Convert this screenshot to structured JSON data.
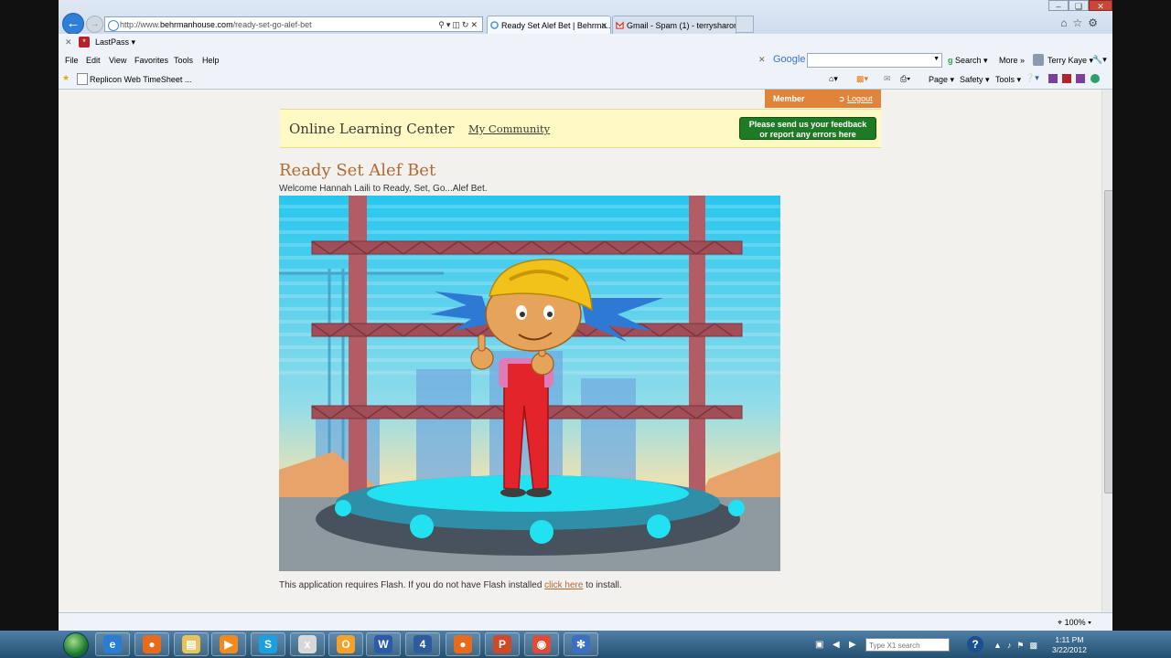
{
  "browser": {
    "address_url_prefix": "http://www.",
    "address_url_domain": "behrmanhouse.com",
    "address_url_path": "/ready-set-go-alef-bet",
    "tabs": [
      {
        "label": "Ready Set Alef Bet | Behrma..."
      },
      {
        "label": "Gmail - Spam (1) - terrysharon..."
      }
    ],
    "lastpass_label": "LastPass",
    "menu": [
      "File",
      "Edit",
      "View",
      "Favorites",
      "Tools",
      "Help"
    ],
    "google_label": "Google",
    "search_label": "Search",
    "more_label": "More",
    "user_label": "Terry Kaye",
    "favorites_item": "Replicon Web TimeSheet",
    "favorites_more": "...",
    "cmd_page": "Page",
    "cmd_safety": "Safety",
    "cmd_tools": "Tools",
    "zoom": "100%"
  },
  "site": {
    "member_label": "Member",
    "logout_label": "Logout",
    "olc_title": "Online Learning Center",
    "community_link": "My Community",
    "feedback_line1": "Please send us your feedback",
    "feedback_line2": "or report any errors here",
    "page_title": "Ready Set Alef Bet",
    "welcome": "Welcome Hannah Laili to Ready, Set, Go...Alef Bet.",
    "flash_note_before": "This application requires Flash.  If you do not have Flash installed ",
    "flash_link": "click here",
    "flash_note_after": " to install."
  },
  "taskbar": {
    "x1_placeholder": "Type X1 search",
    "time": "1:11 PM",
    "date": "3/22/2012",
    "apps": [
      {
        "name": "internet-explorer",
        "glyph": "e",
        "color": "#2b7dd4"
      },
      {
        "name": "firefox",
        "glyph": "●",
        "color": "#e86b1c"
      },
      {
        "name": "file-explorer",
        "glyph": "▤",
        "color": "#e8c35a"
      },
      {
        "name": "media-player",
        "glyph": "▶",
        "color": "#f08a1c"
      },
      {
        "name": "skype",
        "glyph": "S",
        "color": "#1aa0e0"
      },
      {
        "name": "x1-search",
        "glyph": "x",
        "color": "#d8d8d8"
      },
      {
        "name": "outlook",
        "glyph": "O",
        "color": "#f2a22b"
      },
      {
        "name": "word",
        "glyph": "W",
        "color": "#2a5aa8"
      },
      {
        "name": "app-4d",
        "glyph": "4",
        "color": "#2c5c9c"
      },
      {
        "name": "firefox-2",
        "glyph": "●",
        "color": "#e86b1c"
      },
      {
        "name": "powerpoint",
        "glyph": "P",
        "color": "#d24726"
      },
      {
        "name": "chrome",
        "glyph": "◉",
        "color": "#dd4b39"
      },
      {
        "name": "snowflake-app",
        "glyph": "✻",
        "color": "#3b6fc2"
      }
    ]
  }
}
